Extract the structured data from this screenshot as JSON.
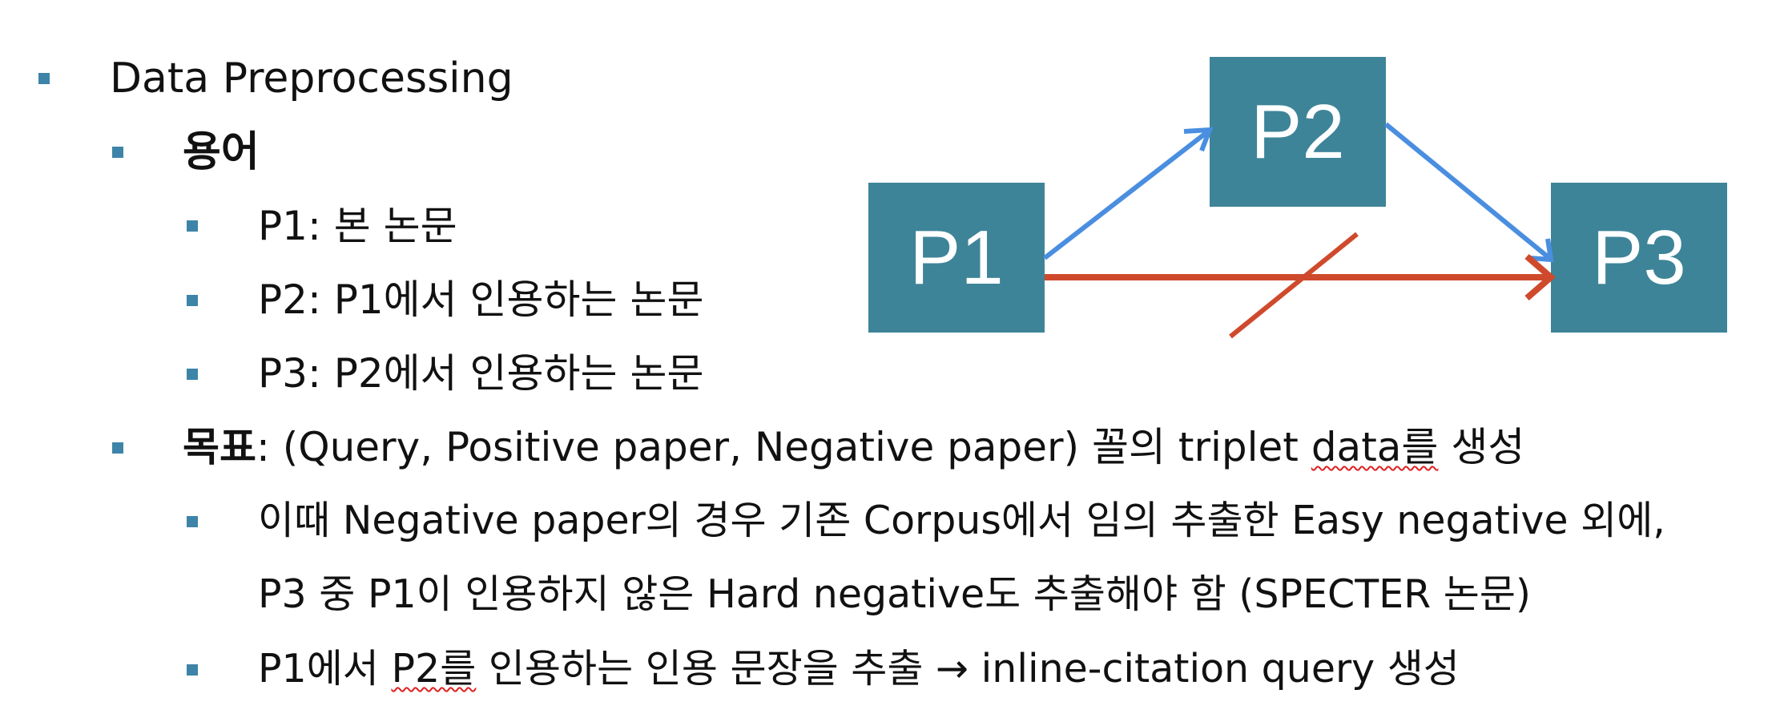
{
  "colors": {
    "bullet": "#3e84a8",
    "box_fill": "#3e8499",
    "blue_arrow": "#4a8ee0",
    "red_arrow": "#cf4a2c"
  },
  "outline": {
    "title": "Data Preprocessing",
    "terms_heading": "용어",
    "terms": [
      "P1: 본 논문",
      "P2: P1에서 인용하는 논문",
      "P3: P2에서 인용하는 논문"
    ],
    "goal_label": "목표",
    "goal_text_pre": ": (Query, Positive paper, Negative paper) 꼴의 triplet ",
    "goal_squiggle": "data를",
    "goal_text_post": " 생성",
    "note1_line1": "이때 Negative paper의 경우 기존 Corpus에서 임의 추출한 Easy negative 외에,",
    "note1_line2": "P3 중 P1이 인용하지 않은 Hard negative도 추출해야 함 (SPECTER 논문)",
    "note2_pre": "P1에서 ",
    "note2_squiggle": "P2를",
    "note2_post": " 인용하는 인용 문장을 추출 → inline-citation query 생성"
  },
  "diagram": {
    "nodes": [
      "P1",
      "P2",
      "P3"
    ]
  }
}
